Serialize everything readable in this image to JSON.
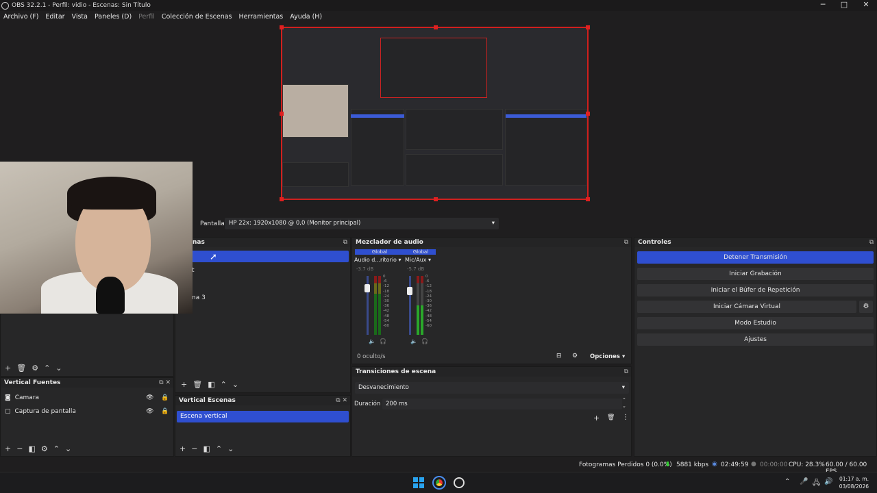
{
  "window": {
    "title": "OBS 32.2.1 - Perfil: vidio - Escenas: Sin Título",
    "minimize": "─",
    "maximize": "□",
    "close": "✕"
  },
  "menu": [
    "Archivo (F)",
    "Editar",
    "Vista",
    "Paneles (D)",
    "Perfil",
    "Colección de Escenas",
    "Herramientas",
    "Ayuda (H)"
  ],
  "pantalla": {
    "label": "Pantalla",
    "value": "HP 22x: 1920x1080 @ 0,0 (Monitor principal)"
  },
  "escenas": {
    "title": "nas",
    "items": [
      {
        "label": ""
      },
      {
        "label": "t"
      },
      {
        "label": ""
      },
      {
        "label": "na 3"
      }
    ]
  },
  "vertical_fuentes": {
    "title": "Vertical Fuentes",
    "items": [
      {
        "label": "Camara",
        "icon": "camera-icon"
      },
      {
        "label": "Captura de pantalla",
        "icon": "monitor-icon"
      }
    ]
  },
  "vertical_escenas": {
    "title": "Vertical Escenas",
    "items": [
      "Escena vertical"
    ]
  },
  "audio": {
    "title": "Mezclador de audio",
    "channels": [
      {
        "global": "Global",
        "name": "Audio d...ritorio",
        "db": "-3.7 dB",
        "level": 0.55
      },
      {
        "global": "Global",
        "name": "Mic/Aux",
        "db": "-5.7 dB",
        "level": 0.45
      }
    ],
    "scale": [
      "0",
      "-6",
      "-12",
      "-18",
      "-24",
      "-30",
      "-36",
      "-42",
      "-48",
      "-54",
      "-60"
    ],
    "hidden": "0 oculto/s",
    "options": "Opciones"
  },
  "transiciones": {
    "title": "Transiciones de escena",
    "type": "Desvanecimiento",
    "duration_label": "Duración",
    "duration": "200 ms"
  },
  "controles": {
    "title": "Controles",
    "buttons": [
      "Detener Transmisión",
      "Iniciar Grabación",
      "Iniciar el Búfer de Repetición",
      "Iniciar Cámara Virtual",
      "Modo Estudio",
      "Ajustes"
    ],
    "accent": "#2f4fd0"
  },
  "status": {
    "dropped": "Fotogramas Perdidos 0 (0.0%)",
    "bitrate": "5881 kbps",
    "stream_time": "02:49:59",
    "rec_time": "00:00:00",
    "cpu": "CPU: 28.3%",
    "fps": "60.00 / 60.00 FPS"
  },
  "taskbar": {
    "time": "01:17 a. m.",
    "date": "03/08/2026"
  }
}
